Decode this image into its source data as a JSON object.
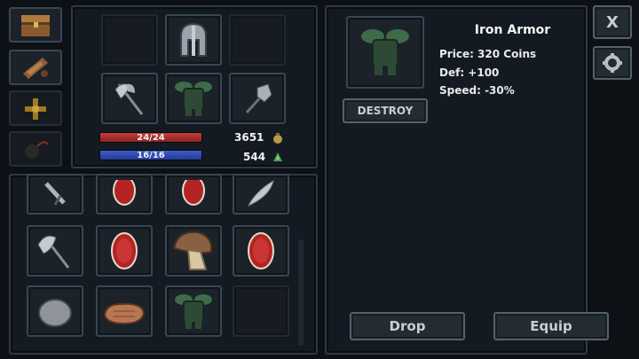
{
  "equipment": {
    "hp": "24/24",
    "mp": "16/16",
    "coins": "3651",
    "gems": "544"
  },
  "item": {
    "name": "Iron Armor",
    "price": "Price: 320 Coins",
    "def": "Def: +100",
    "speed": "Speed: -30%"
  },
  "buttons": {
    "destroy": "DESTROY",
    "drop": "Drop",
    "equip": "Equip",
    "close": "X"
  },
  "icons": {
    "tabs": [
      "chest-icon",
      "scroll-icon",
      "gold-cross-icon",
      "bomb-icon"
    ],
    "equipped": [
      "helmet-icon",
      "battle-axe-icon",
      "iron-armor-icon",
      "mace-icon"
    ],
    "inventory": [
      "sword-icon",
      "ruby-gem-icon",
      "ruby-gem-icon",
      "feather-icon",
      "battle-axe-icon",
      "ruby-gem-icon",
      "mushroom-icon",
      "ruby-gem-icon",
      "stone-icon",
      "steak-icon",
      "iron-armor-icon",
      "empty-slot"
    ]
  },
  "colors": {
    "hp_bar": "#c43b3b",
    "mp_bar": "#3c5fc8",
    "panel": "#141a21"
  }
}
